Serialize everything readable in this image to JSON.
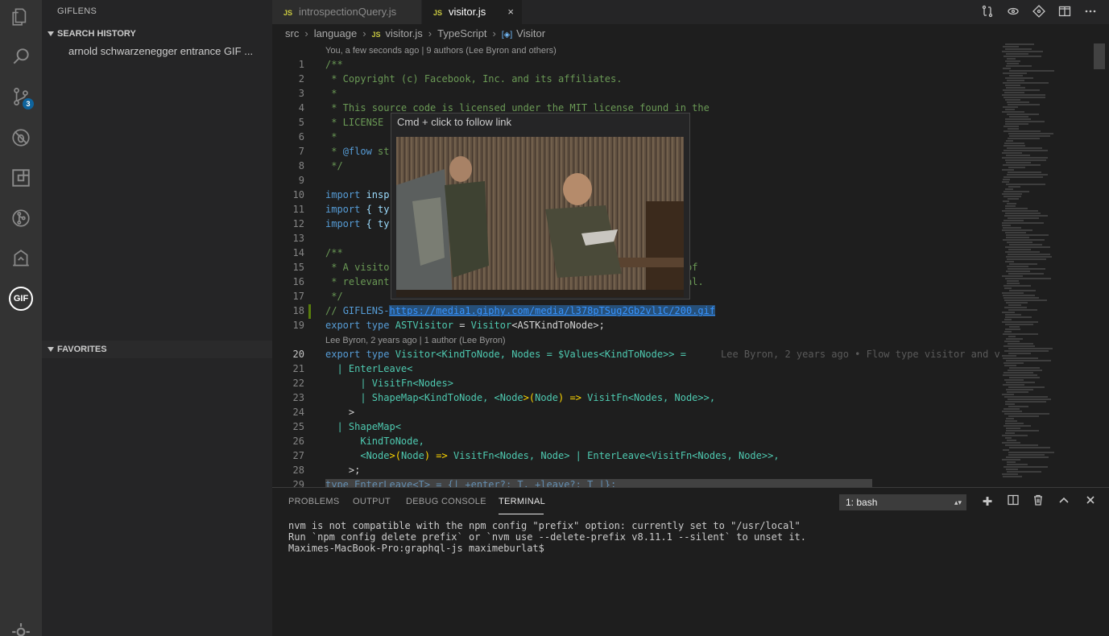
{
  "sidebar": {
    "title": "GIFLENS",
    "search_history": {
      "header": "SEARCH HISTORY",
      "items": [
        "arnold schwarzenegger entrance GIF ..."
      ]
    },
    "favorites": {
      "header": "FAVORITES"
    }
  },
  "activity": {
    "scm_badge": "3",
    "gif_label": "GIF"
  },
  "tabs": [
    {
      "icon": "JS",
      "label": "introspectionQuery.js"
    },
    {
      "icon": "JS",
      "label": "visitor.js",
      "close": "×"
    }
  ],
  "breadcrumb": {
    "items": [
      "src",
      "language",
      "visitor.js",
      "TypeScript",
      "Visitor"
    ],
    "js_icon": "JS"
  },
  "editor": {
    "codelens_1": "You, a few seconds ago | 9 authors (Lee Byron and others)",
    "codelens_2": "Lee Byron, 2 years ago | 1 author (Lee Byron)",
    "blame_inline": "Lee Byron, 2 years ago • Flow type visitor and v",
    "lines": [
      "1",
      "2",
      "3",
      "4",
      "5",
      "6",
      "7",
      "8",
      "9",
      "10",
      "11",
      "12",
      "13",
      "14",
      "15",
      "16",
      "17",
      "18",
      "19",
      "20",
      "21",
      "22",
      "23",
      "24",
      "25",
      "26",
      "27",
      "28",
      "29"
    ],
    "code": {
      "l1": "/**",
      "l2": " * Copyright (c) Facebook, Inc. and its affiliates.",
      "l3": " *",
      "l4": " * This source code is licensed under the MIT license found in the",
      "l5": " * LICENSE",
      "l6": " *",
      "l7_a": " * ",
      "l7_b": "@flow",
      "l7_c": " st",
      "l8": " */",
      "l10_a": "import",
      "l10_b": " insp",
      "l11_a": "import",
      "l11_b": " { ty",
      "l12_a": "import",
      "l12_b": " { ty",
      "l14": "/**",
      "l15_a": " * A visito",
      "l15_b": "of",
      "l16_a": " * relevant",
      "l16_b": "al.",
      "l17": " */",
      "l18_a": "// ",
      "l18_b": "GIFLENS-",
      "l18_link": "https://media1.giphy.com/media/l378pTSug2Gb2vl1C/200.gif",
      "l19_kw": "export type",
      "l19_name": "ASTVisitor",
      "l19_rest": " = ",
      "l19_t1": "Visitor",
      "l19_t2": "<ASTKindToNode>;",
      "l20_kw": "export type",
      "l20_name": "Visitor",
      "l20_gen": "<KindToNode, Nodes = ",
      "l20_vals": "$Values",
      "l20_end": "<KindToNode>> =",
      "l21": "  | EnterLeave<",
      "l22": "      | VisitFn<Nodes>",
      "l23_a": "      | ShapeMap<KindToNode, <",
      "l23_b": "Node",
      "l23_c": ">(",
      "l23_d": "Node",
      "l23_e": ") => ",
      "l23_f": "VisitFn<Nodes, Node>>,",
      "l24": "    >",
      "l25": "  | ShapeMap<",
      "l26": "      KindToNode,",
      "l27_a": "      <",
      "l27_b": "Node",
      "l27_c": ">(",
      "l27_d": "Node",
      "l27_e": ") => ",
      "l27_f": "VisitFn<Nodes, Node> | EnterLeave<VisitFn<Nodes, Node>>,",
      "l28": "    >;",
      "l29": "type EnterLeave<T> = {| +enter?: T, +leave?: T |};"
    }
  },
  "hover": {
    "text": "Cmd + click to follow link"
  },
  "panel": {
    "tabs": [
      "PROBLEMS",
      "OUTPUT",
      "DEBUG CONSOLE",
      "TERMINAL"
    ],
    "terminal_select": "1: bash",
    "terminal_lines": [
      "nvm is not compatible with the npm config \"prefix\" option: currently set to \"/usr/local\"",
      "Run `npm config delete prefix` or `nvm use --delete-prefix v8.11.1 --silent` to unset it.",
      "Maximes-MacBook-Pro:graphql-js maximeburlat$ "
    ]
  },
  "colors": {
    "activity_bg": "#333333",
    "sidebar_bg": "#252526",
    "editor_bg": "#1e1e1e",
    "badge": "#0e639c",
    "link": "#3794ff",
    "comment": "#6a9955",
    "keyword": "#569cd6",
    "type": "#4ec9b0"
  }
}
